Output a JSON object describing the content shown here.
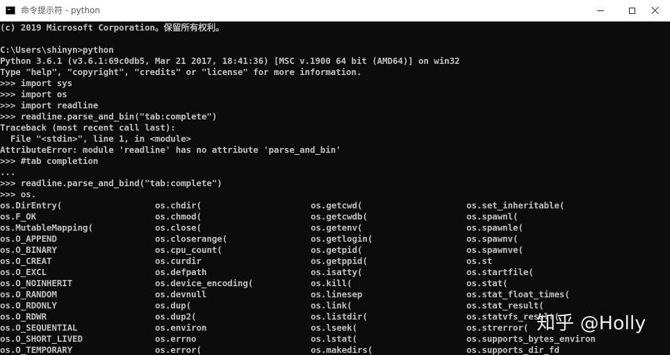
{
  "window": {
    "title": "命令提示符 - python"
  },
  "console": {
    "lines": [
      "(c) 2019 Microsoft Corporation。保留所有权利。",
      "",
      "C:\\Users\\shinyn>python",
      "Python 3.6.1 (v3.6.1:69c0db5, Mar 21 2017, 18:41:36) [MSC v.1900 64 bit (AMD64)] on win32",
      "Type \"help\", \"copyright\", \"credits\" or \"license\" for more information.",
      ">>> import sys",
      ">>> import os",
      ">>> import readline",
      ">>> readline.parse_and_bin(\"tab:complete\")",
      "Traceback (most recent call last):",
      "  File \"<stdin>\", line 1, in <module>",
      "AttributeError: module 'readline' has no attribute 'parse_and_bin'",
      ">>> #tab completion",
      "...",
      ">>> readline.parse_and_bind(\"tab:complete\")",
      ">>> os."
    ],
    "completions": [
      [
        "os.DirEntry(",
        "os.chdir(",
        "os.getcwd(",
        "os.set_inheritable("
      ],
      [
        "os.F_OK",
        "os.chmod(",
        "os.getcwdb(",
        "os.spawnl("
      ],
      [
        "os.MutableMapping(",
        "os.close(",
        "os.getenv(",
        "os.spawnle("
      ],
      [
        "os.O_APPEND",
        "os.closerange(",
        "os.getlogin(",
        "os.spawnv("
      ],
      [
        "os.O_BINARY",
        "os.cpu_count(",
        "os.getpid(",
        "os.spawnve("
      ],
      [
        "os.O_CREAT",
        "os.curdir",
        "os.getppid(",
        "os.st"
      ],
      [
        "os.O_EXCL",
        "os.defpath",
        "os.isatty(",
        "os.startfile("
      ],
      [
        "os.O_NOINHERIT",
        "os.device_encoding(",
        "os.kill(",
        "os.stat("
      ],
      [
        "os.O_RANDOM",
        "os.devnull",
        "os.linesep",
        "os.stat_float_times("
      ],
      [
        "os.O_RDONLY",
        "os.dup(",
        "os.link(",
        "os.stat_result("
      ],
      [
        "os.O_RDWR",
        "os.dup2(",
        "os.listdir(",
        "os.statvfs_result("
      ],
      [
        "os.O_SEQUENTIAL",
        "os.environ",
        "os.lseek(",
        "os.strerror("
      ],
      [
        "os.O_SHORT_LIVED",
        "os.errno",
        "os.lstat(",
        "os.supports_bytes_environ"
      ],
      [
        "os.O_TEMPORARY",
        "os.error(",
        "os.makedirs(",
        "os.supports_dir_fd"
      ]
    ]
  },
  "watermark": {
    "text": "知乎 @Holly"
  },
  "colors": {
    "console_bg": "#0c0c0c",
    "console_text": "#c0c0c0",
    "titlebar_bg": "#ffffff"
  },
  "icons": {
    "app": "cmd-icon",
    "minimize": "minimize-icon",
    "maximize": "maximize-icon",
    "close": "close-icon"
  }
}
